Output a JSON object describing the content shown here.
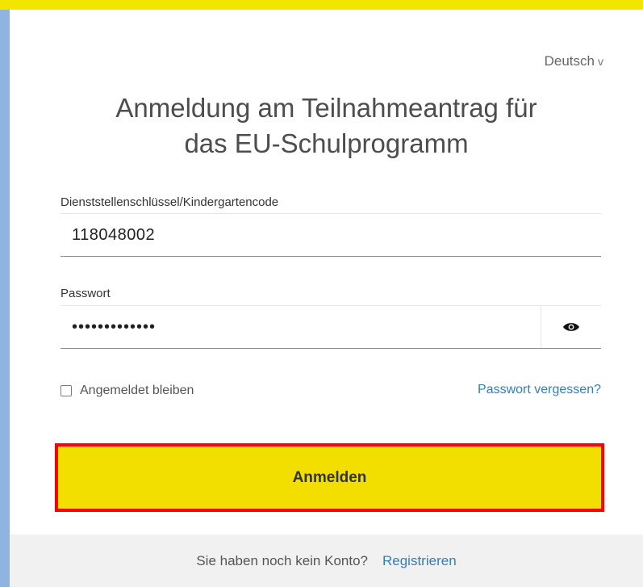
{
  "language": {
    "label": "Deutsch",
    "chevron": "v"
  },
  "title": {
    "line1": "Anmeldung am Teilnahmeantrag für",
    "line2": "das EU-Schulprogramm"
  },
  "fields": {
    "code": {
      "label": "Dienststellenschlüssel/Kindergartencode",
      "value": "118048002"
    },
    "password": {
      "label": "Passwort",
      "value": "•••••••••••••"
    }
  },
  "remember": {
    "label": "Angemeldet bleiben",
    "checked": false
  },
  "forgot": {
    "label": "Passwort vergessen?"
  },
  "login": {
    "label": "Anmelden"
  },
  "footer": {
    "text": "Sie haben noch kein Konto?",
    "register": "Registrieren"
  },
  "colors": {
    "accent": "#f2df00",
    "link": "#2f7fbf",
    "highlight": "#ff0000"
  },
  "icons": {
    "password_toggle": "eye-icon"
  }
}
